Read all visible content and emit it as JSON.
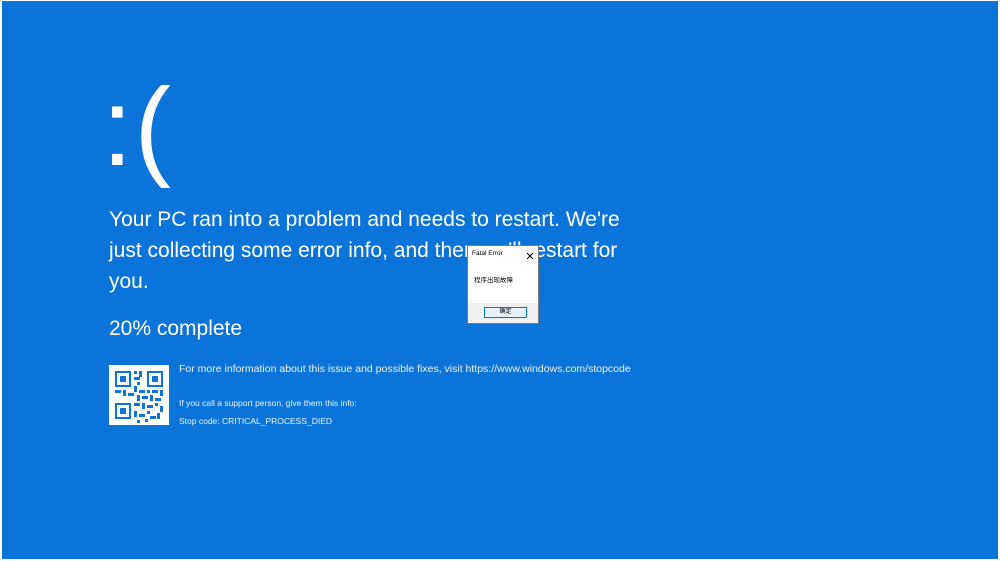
{
  "bsod": {
    "face": ":(",
    "message": "Your PC ran into a problem and needs to restart. We're just collecting some error info, and then we'll restart for you.",
    "progress_text": "20% complete",
    "progress_value": 20,
    "more_info": "For more information about this issue and possible fixes, visit https://www.windows.com/stopcode",
    "support_text": "If you call a support person, give them this info:",
    "stop_code": "Stop code: CRITICAL_PROCESS_DIED"
  },
  "dialog": {
    "title": "Fatal Error",
    "message": "程序出现故障",
    "ok_label": "确定",
    "close_icon": "close-icon"
  },
  "colors": {
    "background": "#0b74d8",
    "text": "#ffffff",
    "dialog_button_border": "#0078d7"
  }
}
